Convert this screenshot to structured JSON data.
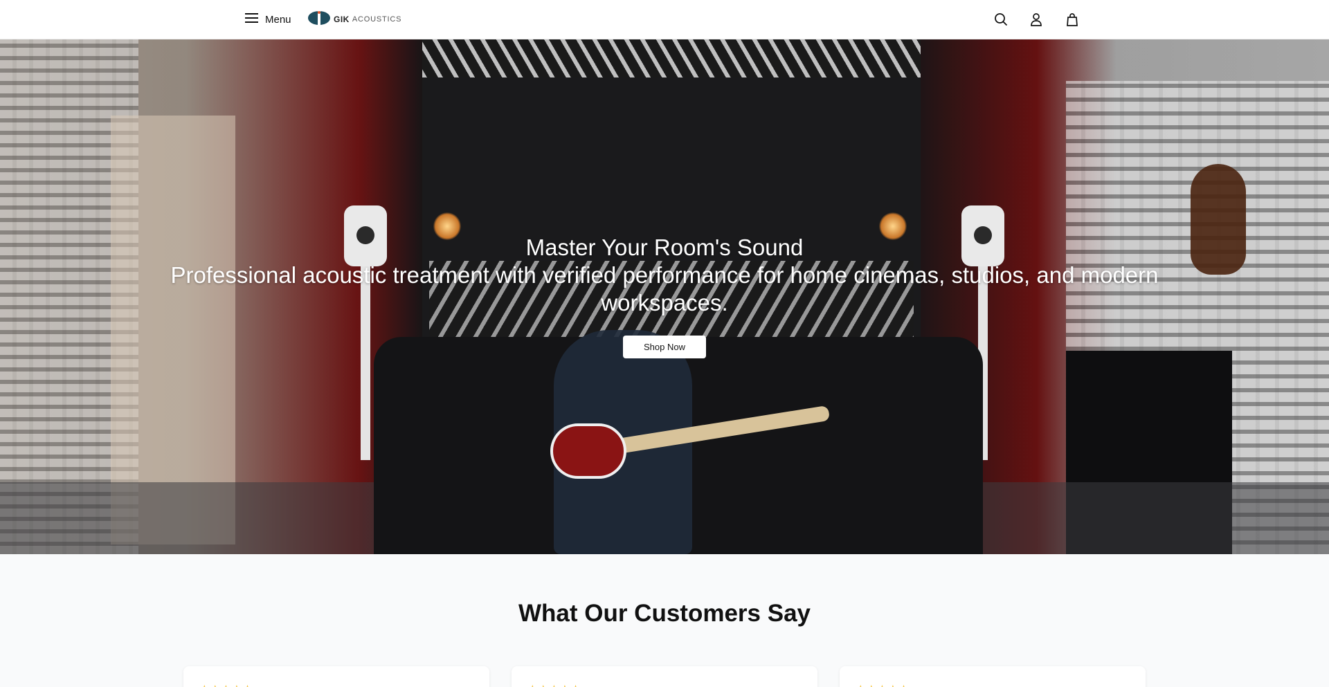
{
  "header": {
    "menu_label": "Menu",
    "logo": {
      "brand": "GIK",
      "sub": "ACOUSTICS"
    },
    "icons": [
      "search-icon",
      "account-icon",
      "cart-icon"
    ]
  },
  "hero": {
    "title": "Master Your Room's Sound",
    "subtitle": "Professional acoustic treatment with verified performance for home cinemas, studios, and modern workspaces.",
    "cta_label": "Shop Now"
  },
  "testimonials": {
    "title": "What Our Customers Say",
    "cards": [
      {
        "stars": "★★★★★"
      },
      {
        "stars": "★★★★★"
      },
      {
        "stars": "★★★★★"
      }
    ]
  },
  "colors": {
    "accent": "#1f4e5f",
    "logo_accent": "#d9532b",
    "header_bg": "#ffffff",
    "section_bg": "#f9fafb",
    "star": "#f5c542"
  }
}
